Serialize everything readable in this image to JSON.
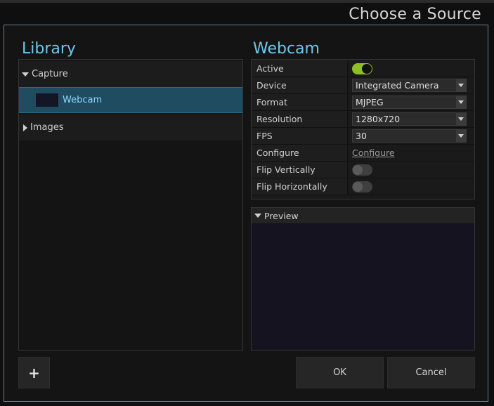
{
  "dialog": {
    "title": "Choose a Source"
  },
  "library": {
    "heading": "Library",
    "items": [
      {
        "label": "Capture",
        "expanded": true
      },
      {
        "label": "Webcam",
        "selected": true
      },
      {
        "label": "Images",
        "expanded": false
      }
    ]
  },
  "source": {
    "heading": "Webcam",
    "properties": {
      "active": {
        "label": "Active",
        "value": true
      },
      "device": {
        "label": "Device",
        "value": "Integrated Camera"
      },
      "format": {
        "label": "Format",
        "value": "MJPEG"
      },
      "resolution": {
        "label": "Resolution",
        "value": "1280x720"
      },
      "fps": {
        "label": "FPS",
        "value": "30"
      },
      "configure": {
        "label": "Configure",
        "link": "Configure"
      },
      "flip_vertical": {
        "label": "Flip Vertically",
        "value": false
      },
      "flip_horizontal": {
        "label": "Flip Horizontally",
        "value": false
      }
    }
  },
  "preview": {
    "label": "Preview"
  },
  "buttons": {
    "add": "+",
    "ok": "OK",
    "cancel": "Cancel"
  },
  "colors": {
    "accent": "#6fc7ea",
    "toggle_on": "#8dbf24",
    "selection": "#1f4c61"
  },
  "icons": {
    "expand": "triangle-down-icon",
    "collapse": "triangle-right-icon",
    "dropdown": "chevron-down-icon"
  }
}
